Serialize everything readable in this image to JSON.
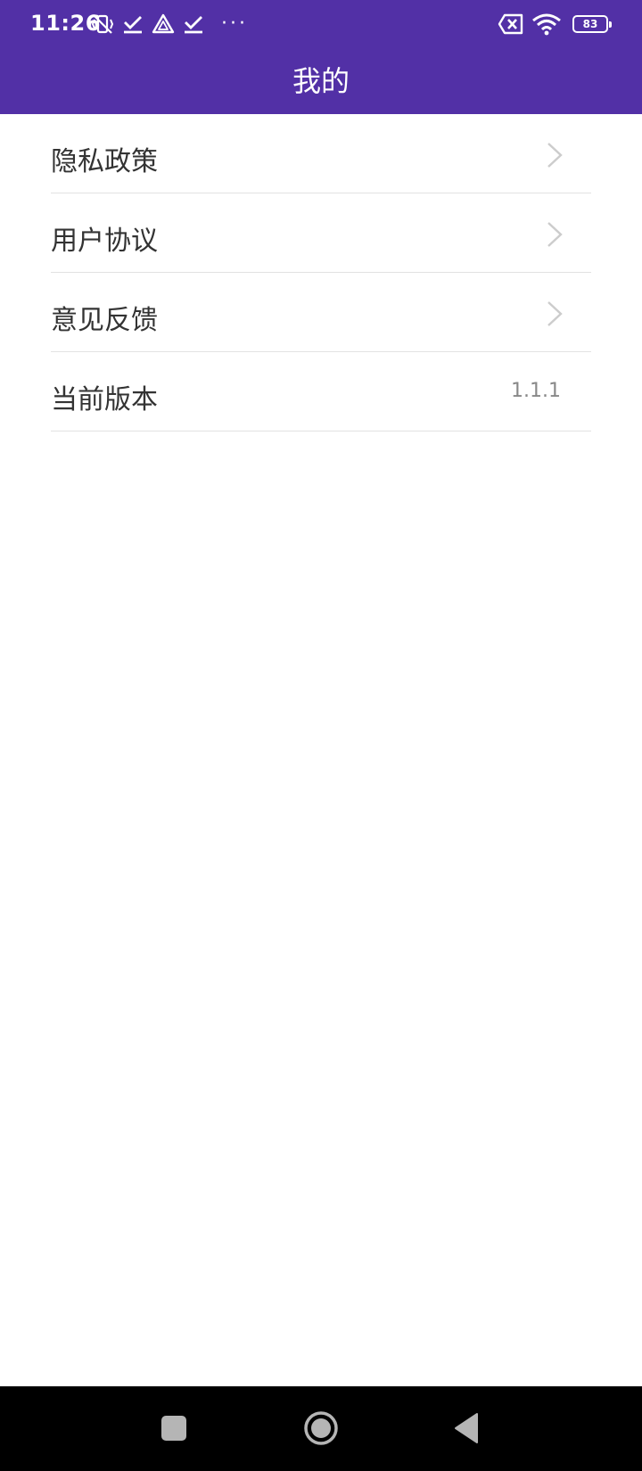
{
  "status_bar": {
    "time": "11:26",
    "left_icons": [
      "vibrate-mute-icon",
      "check-icon",
      "triangle-app-icon",
      "check-icon"
    ],
    "overflow": "···",
    "battery_level": "83"
  },
  "header": {
    "title": "我的",
    "background_color": "#5230a6"
  },
  "menu": {
    "items": [
      {
        "label": "隐私政策"
      },
      {
        "label": "用户协议"
      },
      {
        "label": "意见反馈"
      },
      {
        "label": "当前版本",
        "value": "1.1.1"
      }
    ]
  },
  "nav_bar": {
    "buttons": [
      "recents-icon",
      "home-icon",
      "back-icon"
    ]
  }
}
